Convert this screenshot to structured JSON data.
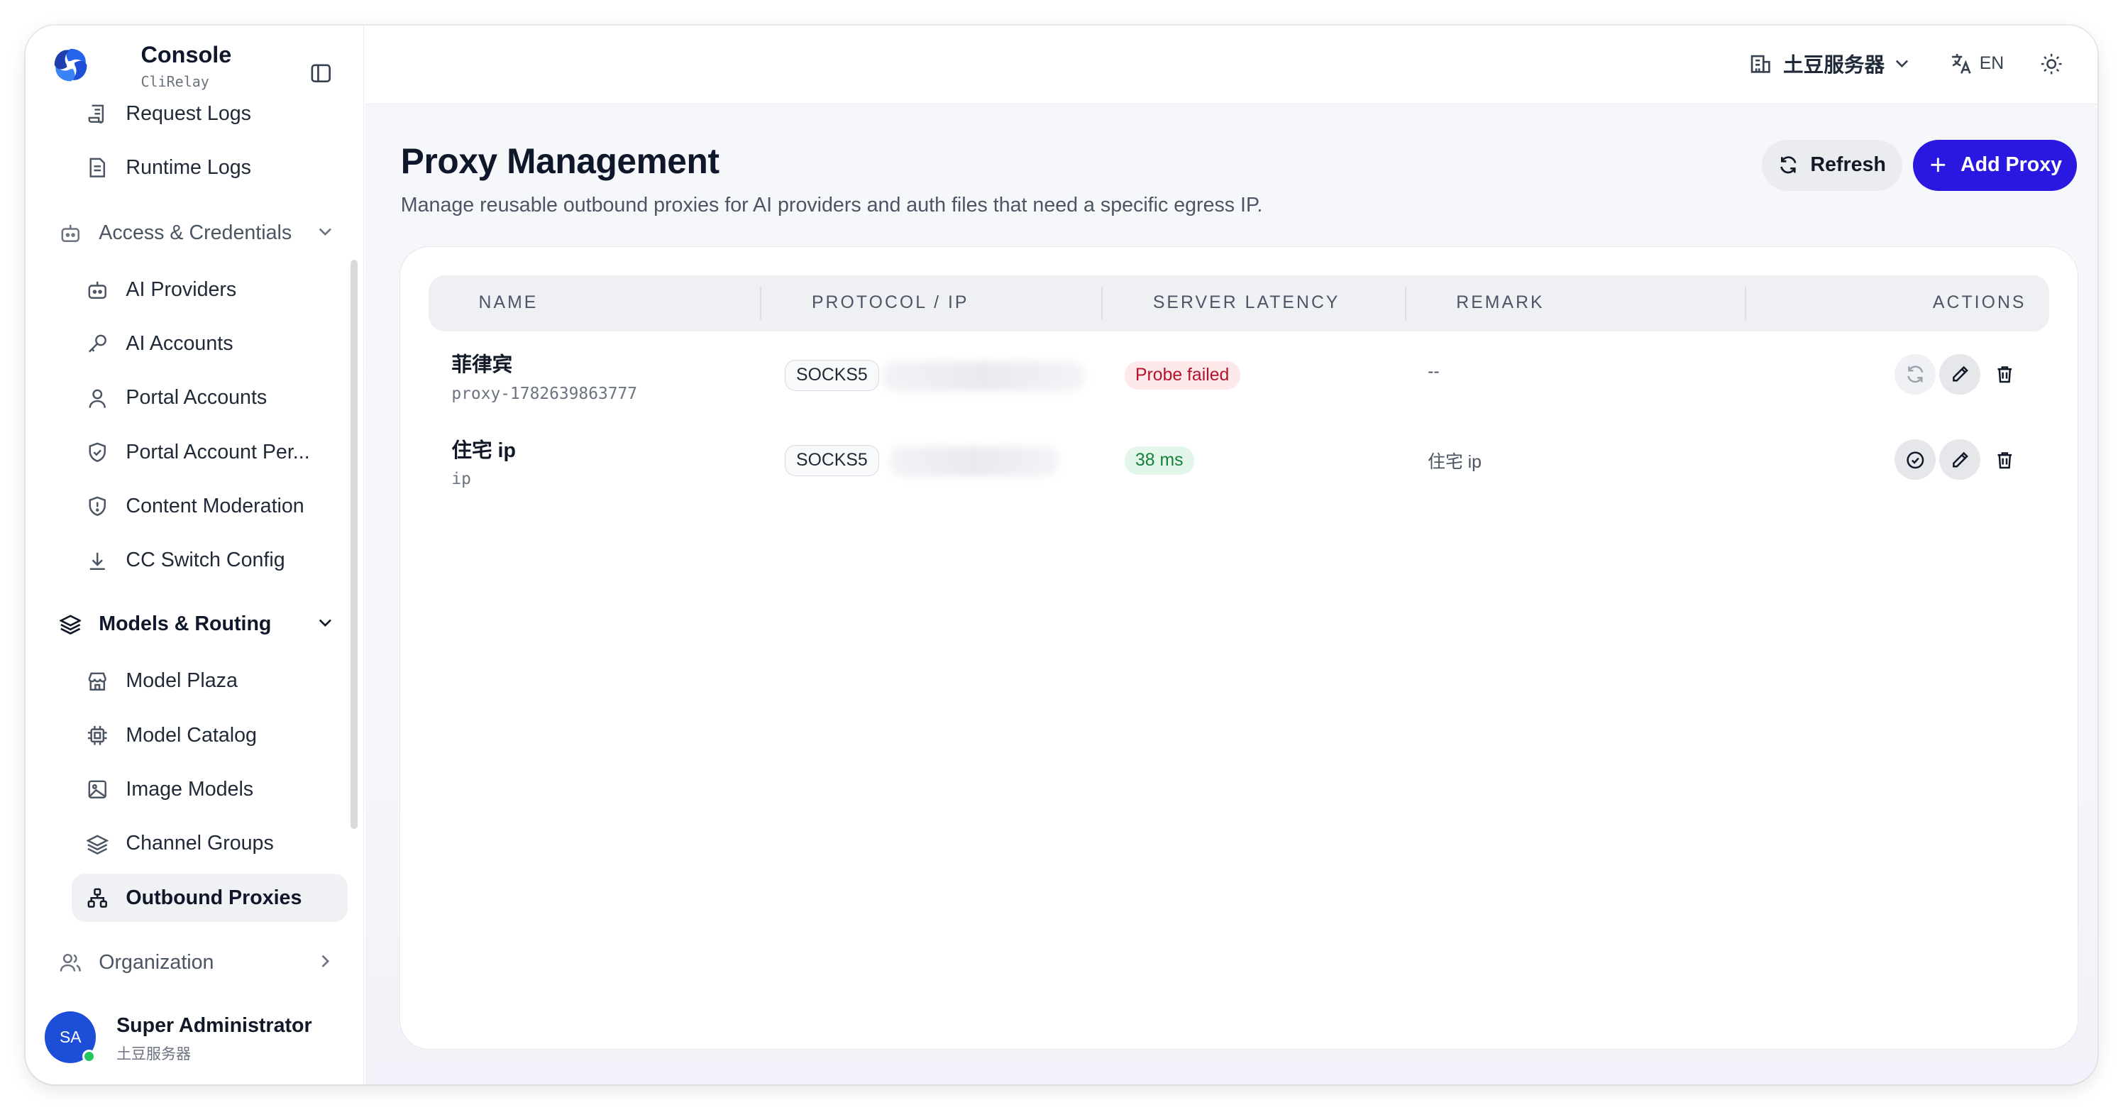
{
  "brand": {
    "title": "Console",
    "subtitle": "CliRelay"
  },
  "sidebar": {
    "items_top": [
      {
        "label": "Request Logs",
        "icon": "scroll-icon"
      },
      {
        "label": "Runtime Logs",
        "icon": "file-text-icon"
      }
    ],
    "group_access": {
      "label": "Access & Credentials",
      "expanded": true
    },
    "items_access": [
      {
        "label": "AI Providers",
        "icon": "bot-icon"
      },
      {
        "label": "AI Accounts",
        "icon": "key-icon"
      },
      {
        "label": "Portal Accounts",
        "icon": "user-icon"
      },
      {
        "label": "Portal Account Per...",
        "icon": "shield-check-icon"
      },
      {
        "label": "Content Moderation",
        "icon": "shield-alert-icon"
      },
      {
        "label": "CC Switch Config",
        "icon": "download-icon"
      }
    ],
    "group_models": {
      "label": "Models & Routing",
      "expanded": true
    },
    "items_models": [
      {
        "label": "Model Plaza",
        "icon": "store-icon"
      },
      {
        "label": "Model Catalog",
        "icon": "cpu-icon"
      },
      {
        "label": "Image Models",
        "icon": "image-icon"
      },
      {
        "label": "Channel Groups",
        "icon": "layers-icon"
      },
      {
        "label": "Outbound Proxies",
        "icon": "network-icon",
        "active": true
      }
    ],
    "group_org": {
      "label": "Organization",
      "expanded": false
    },
    "user": {
      "initials": "SA",
      "name": "Super Administrator",
      "org": "土豆服务器",
      "status": "online"
    }
  },
  "topbar": {
    "tenant": "土豆服务器",
    "language": "EN"
  },
  "page": {
    "title": "Proxy Management",
    "description": "Manage reusable outbound proxies for AI providers and auth files that need a specific egress IP.",
    "refresh_label": "Refresh",
    "add_label": "Add Proxy"
  },
  "table": {
    "columns": [
      "NAME",
      "PROTOCOL / IP",
      "SERVER LATENCY",
      "REMARK",
      "ACTIONS"
    ],
    "rows": [
      {
        "name": "菲律宾",
        "id": "proxy-1782639863777",
        "protocol": "SOCKS5",
        "latency": "Probe failed",
        "latency_status": "failed",
        "remark": "--"
      },
      {
        "name": "住宅 ip",
        "id": "ip",
        "protocol": "SOCKS5",
        "latency": "38 ms",
        "latency_status": "ok",
        "remark": "住宅 ip"
      }
    ]
  },
  "colors": {
    "accent": "#2a17e0",
    "fail": "#b4132c",
    "ok": "#14803c",
    "avatar": "#1d4ed8"
  }
}
